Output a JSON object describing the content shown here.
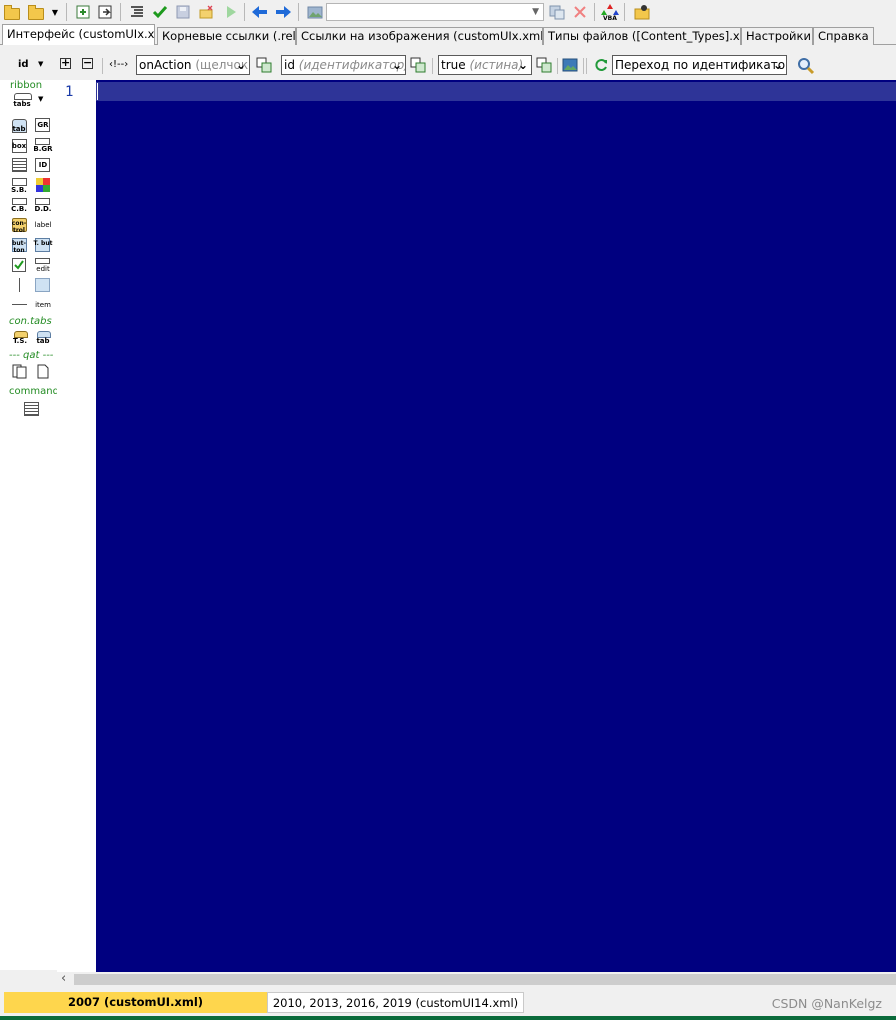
{
  "tabs": [
    {
      "label": "Интерфейс (customUIx.xml)",
      "active": true
    },
    {
      "label": "Корневые ссылки (.rels)",
      "active": false
    },
    {
      "label": "Ссылки на изображения  (customUIx.xml.rels)",
      "active": false
    },
    {
      "label": "Типы файлов ([Content_Types].xml)",
      "active": false
    },
    {
      "label": "Настройки",
      "active": false
    },
    {
      "label": "Справка",
      "active": false
    }
  ],
  "toolbar2": {
    "id_label": "id",
    "comment_label": "‹!--›",
    "callback_select": {
      "value": "onAction",
      "hint": "(щелчок"
    },
    "attr_select": {
      "value": "id",
      "hint": "(идентификатор)"
    },
    "bool_select": {
      "value": "true",
      "hint": "(истина)"
    },
    "goto_select": {
      "value": "Переход по идентификатору"
    }
  },
  "palette": {
    "ribbon": "ribbon",
    "tabs": "tabs",
    "tab": "tab",
    "gr": "GR",
    "box": "box",
    "bgr": "B.GR",
    "id": "ID",
    "sb": "S.B.",
    "cb": "C.B.",
    "dd": "D.D.",
    "control": "con-trol",
    "label": "label",
    "button": "but-ton",
    "tbut": "T. but",
    "edit": "edit",
    "item": "item",
    "con_tabs": "con.tabs",
    "ts": "T.S.",
    "tab2": "tab",
    "qat": "--- qat ---",
    "commands": "commands"
  },
  "editor": {
    "line_number": "1"
  },
  "bottom": {
    "active_tab": "2007 (customUI.xml)",
    "inactive_tab": "2010, 2013, 2016, 2019 (customUI14.xml)",
    "watermark": "CSDN @NanKelgz"
  },
  "colors": {
    "editor_bg": "#000080",
    "current_line": "#2e3498",
    "active_bottom_tab": "#fed64d",
    "palette_headers": "#228b22"
  }
}
